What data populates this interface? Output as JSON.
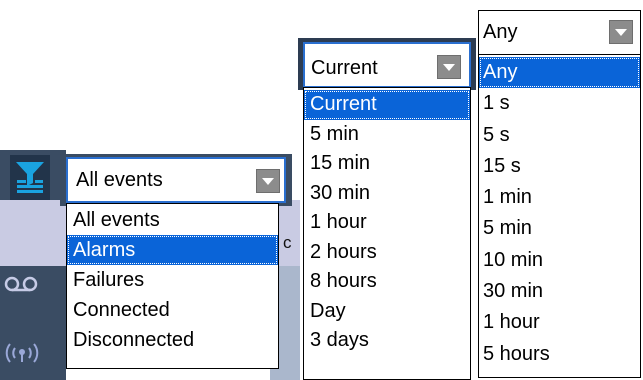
{
  "event_filter": {
    "selected": "All events",
    "options": [
      "All events",
      "Alarms",
      "Failures",
      "Connected",
      "Disconnected"
    ],
    "highlighted_index": 1,
    "peek_text": "c"
  },
  "time_filter": {
    "selected": "Current",
    "options": [
      "Current",
      "5 min",
      "15 min",
      "30 min",
      "1 hour",
      "2 hours",
      "8 hours",
      "Day",
      "3 days"
    ],
    "highlighted_index": 0
  },
  "duration_filter": {
    "selected": "Any",
    "options": [
      "Any",
      "1 s",
      "5 s",
      "15 s",
      "1 min",
      "5 min",
      "10 min",
      "30 min",
      "1 hour",
      "5 hours"
    ],
    "highlighted_index": 0
  },
  "icons": [
    "filter-icon",
    "voicemail-icon",
    "broadcast-icon"
  ],
  "colors": {
    "selection": "#0a64d8",
    "focus_border": "#2a6fd0",
    "panel_dark": "#3a4c63",
    "panel_lavender": "#c9cbe3"
  }
}
